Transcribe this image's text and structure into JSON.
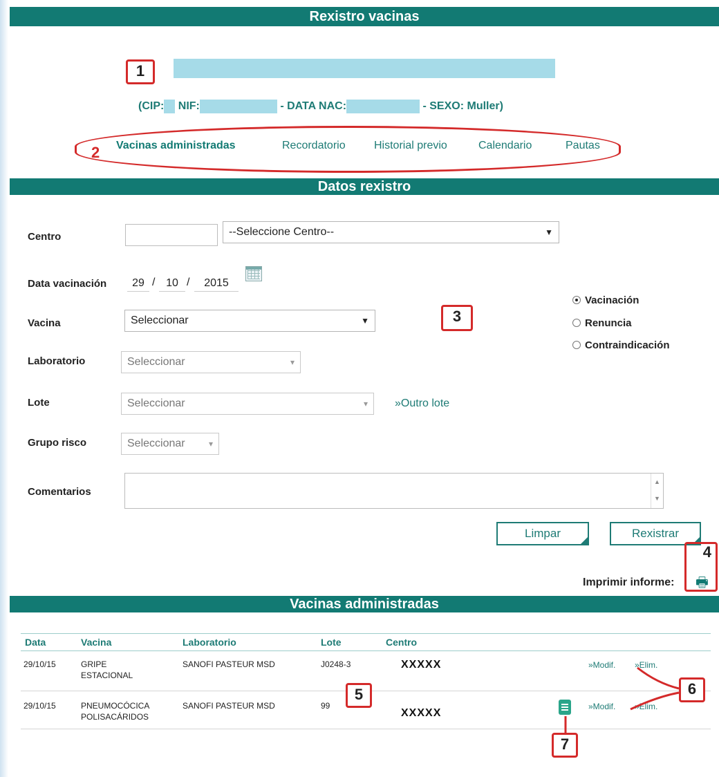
{
  "header": {
    "title": "Rexistro vacinas"
  },
  "patient": {
    "cip_label": "(CIP:",
    "nif_label": "NIF:",
    "birth_label": "- DATA NAC:",
    "sex_label": "- SEXO: Muller)"
  },
  "tabs": [
    {
      "label": "Vacinas administradas",
      "active": true
    },
    {
      "label": "Recordatorio",
      "active": false
    },
    {
      "label": "Historial previo",
      "active": false
    },
    {
      "label": "Calendario",
      "active": false
    },
    {
      "label": "Pautas",
      "active": false
    }
  ],
  "form_section": {
    "title": "Datos rexistro"
  },
  "form": {
    "centro_label": "Centro",
    "centro_select": "--Seleccione Centro--",
    "date_label": "Data vacinación",
    "date_day": "29",
    "date_month": "10",
    "date_year": "2015",
    "date_sep": "/",
    "vacina_label": "Vacina",
    "vacina_select": "Seleccionar",
    "laboratorio_label": "Laboratorio",
    "laboratorio_select": "Seleccionar",
    "lote_label": "Lote",
    "lote_select": "Seleccionar",
    "outro_lote_link": "»Outro lote",
    "grupo_risco_label": "Grupo risco",
    "grupo_risco_select": "Seleccionar",
    "comentarios_label": "Comentarios",
    "type_options": [
      {
        "label": "Vacinación",
        "selected": true
      },
      {
        "label": "Renuncia",
        "selected": false
      },
      {
        "label": "Contraindicación",
        "selected": false
      }
    ],
    "clear_button": "Limpar",
    "register_button": "Rexistrar"
  },
  "print": {
    "label": "Imprimir informe:",
    "icon": "printer-icon"
  },
  "table_section": {
    "title": "Vacinas administradas"
  },
  "table": {
    "columns": [
      "Data",
      "Vacina",
      "Laboratorio",
      "Lote",
      "Centro"
    ],
    "rows": [
      {
        "date": "29/10/15",
        "vaccine_line1": "GRIPE",
        "vaccine_line2": "ESTACIONAL",
        "lab": "SANOFI PASTEUR MSD",
        "lot": "J0248-3",
        "centro": "XXXXX",
        "modify": "»Modif.",
        "delete": "»Elim."
      },
      {
        "date": "29/10/15",
        "vaccine_line1": "PNEUMOCÓCICA",
        "vaccine_line2": "POLISACÁRIDOS",
        "lab": "SANOFI PASTEUR MSD",
        "lot": "99",
        "centro": "XXXXX",
        "modify": "»Modif.",
        "delete": "»Elim."
      }
    ]
  },
  "markers": [
    "1",
    "2",
    "3",
    "4",
    "5",
    "6",
    "7"
  ],
  "colors": {
    "header": "#127a73",
    "link": "#1e7b75",
    "marker": "#d42a2a",
    "redaction": "#a6dbe8"
  }
}
